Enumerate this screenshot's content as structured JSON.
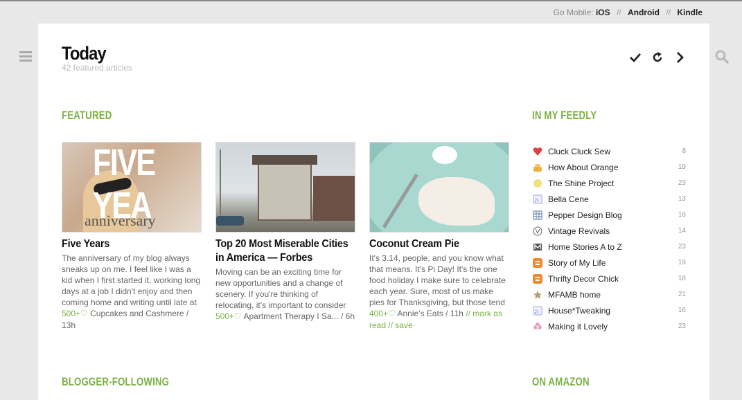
{
  "gomobile": {
    "label": "Go Mobile:",
    "links": [
      "iOS",
      "Android",
      "Kindle"
    ],
    "sep": "//"
  },
  "header": {
    "title": "Today",
    "subtitle": "42 featured articles"
  },
  "sections": {
    "featured": "FEATURED",
    "in_my_feedly": "IN MY FEEDLY",
    "blogger_following": "BLOGGER-FOLLOWING",
    "on_amazon": "ON AMAZON"
  },
  "articles": [
    {
      "title": "Five Years",
      "thumb_text": [
        "FIVE YEA",
        "anniversary"
      ],
      "body": "The anniversary of my blog always sneaks up on me. I feel like I was a kid when I first started it, working long days at a job I didn't enjoy and then coming home and writing until late at",
      "count": "500+",
      "source": "Cupcakes and Cashmere / 13h"
    },
    {
      "title": "Top 20 Most Miserable Cities in America — Forbes",
      "body": "Moving can be an exciting time for new opportunities and a change of scenery. If you're thinking of relocating, it's important to consider",
      "count": "500+",
      "source": "Apartment Therapy I Sa... / 6h"
    },
    {
      "title": "Coconut Cream Pie",
      "body": "It's 3.14, people, and you know what that means.  It's Pi Day!  It's the one food holiday I make sure to celebrate each year.  Sure, most of us make pies for Thanksgiving, but those tend",
      "count": "400+",
      "source": "Annie's Eats / 11h",
      "mark_as_read": "mark as read",
      "save": "save"
    }
  ],
  "feeds": [
    {
      "name": "Cluck Cluck Sew",
      "count": "8",
      "icon": "heart-icon",
      "color": "#e04040"
    },
    {
      "name": "How About Orange",
      "count": "19",
      "icon": "cake-icon",
      "color": "#f0b040"
    },
    {
      "name": "The Shine Project",
      "count": "23",
      "icon": "circle-icon",
      "color": "#f0e080"
    },
    {
      "name": "Bella Cene",
      "count": "13",
      "icon": "rss-icon",
      "color": "#9aaee0"
    },
    {
      "name": "Pepper Design Blog",
      "count": "16",
      "icon": "grid-icon",
      "color": "#5a7aa0"
    },
    {
      "name": "Vintage Revivals",
      "count": "14",
      "icon": "v-icon",
      "color": "#666666"
    },
    {
      "name": "Home Stories A to Z",
      "count": "23",
      "icon": "m-icon",
      "color": "#555555"
    },
    {
      "name": "Story of My Life",
      "count": "19",
      "icon": "blogger-icon",
      "color": "#f08a30"
    },
    {
      "name": "Thrifty Decor Chick",
      "count": "18",
      "icon": "blogger-icon",
      "color": "#f08a30"
    },
    {
      "name": "MFAMB home",
      "count": "21",
      "icon": "star-icon",
      "color": "#b0a070"
    },
    {
      "name": "House*Tweaking",
      "count": "16",
      "icon": "rss-icon",
      "color": "#9aaee0"
    },
    {
      "name": "Making it Lovely",
      "count": "23",
      "icon": "flower-icon",
      "color": "#e8a0c0"
    }
  ]
}
